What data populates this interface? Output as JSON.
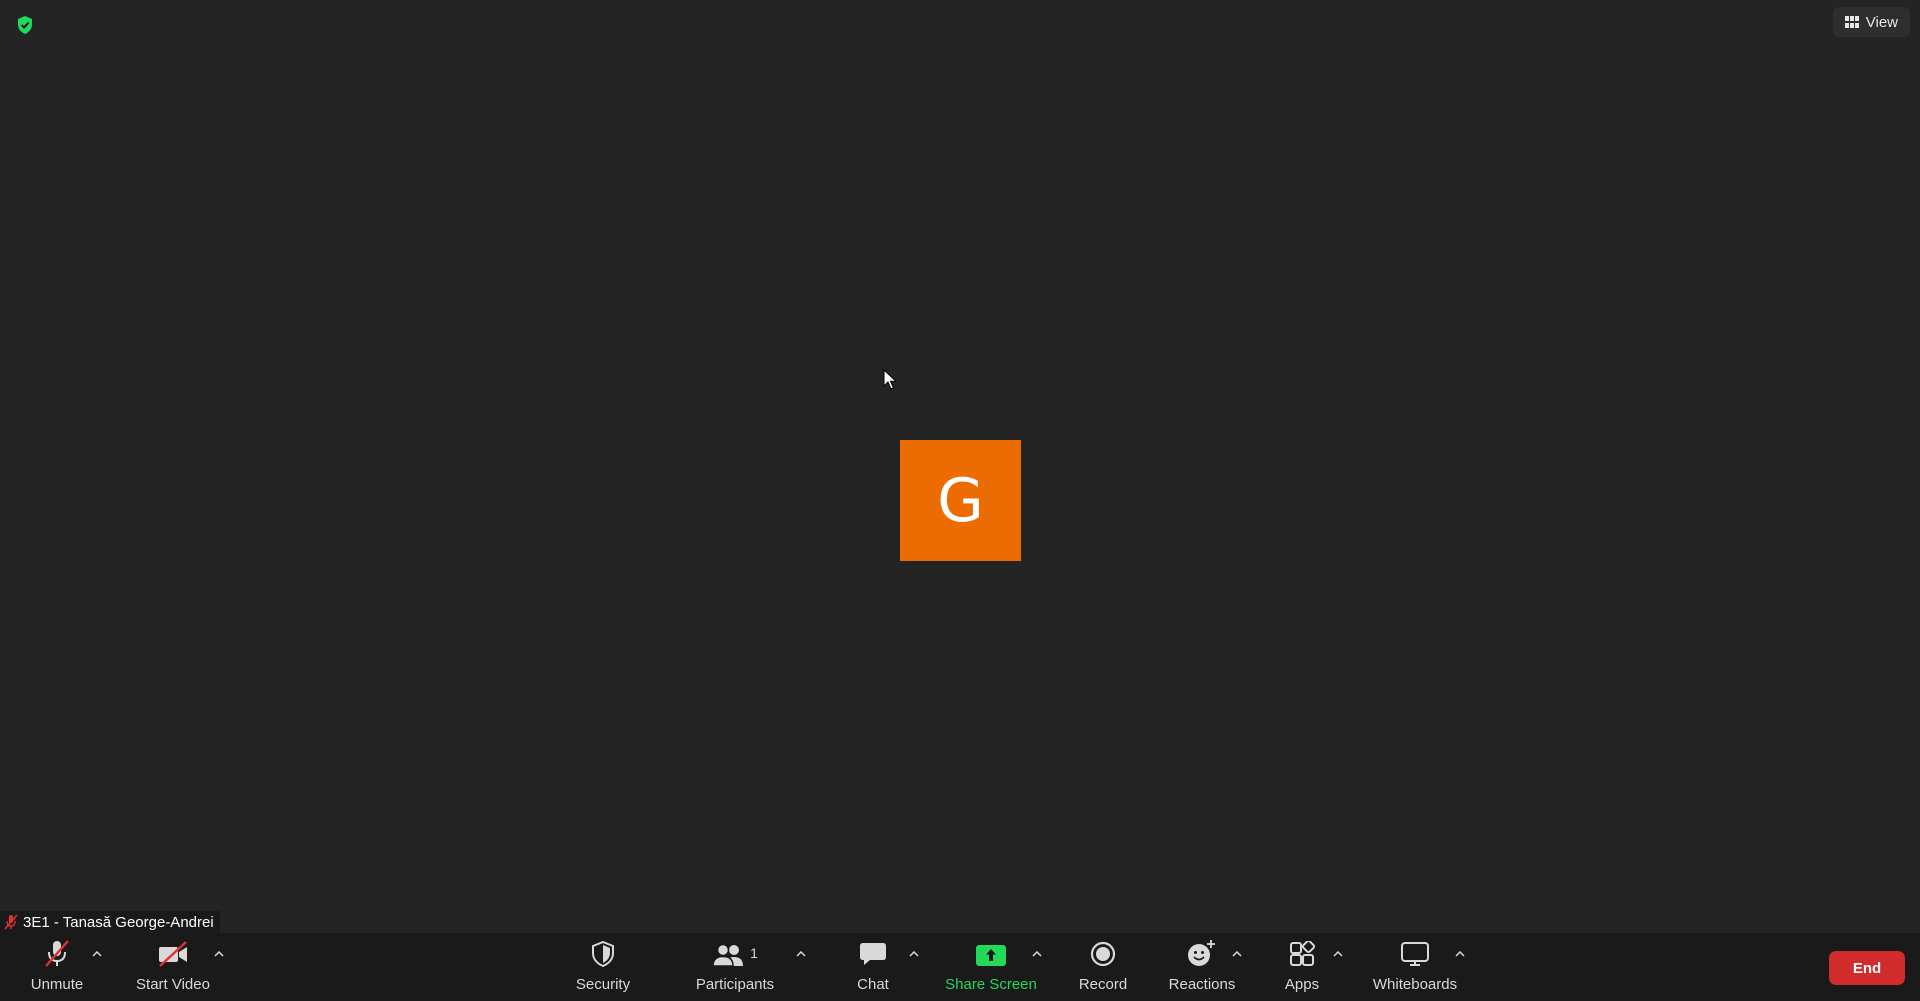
{
  "header": {
    "view_label": "View"
  },
  "participant": {
    "initial": "G",
    "name": "3E1 - Tanasă George-Andrei",
    "avatar_color": "#ed6c02"
  },
  "toolbar": {
    "unmute_label": "Unmute",
    "start_video_label": "Start Video",
    "security_label": "Security",
    "participants_label": "Participants",
    "participants_count": "1",
    "chat_label": "Chat",
    "share_screen_label": "Share Screen",
    "record_label": "Record",
    "reactions_label": "Reactions",
    "apps_label": "Apps",
    "whiteboards_label": "Whiteboards",
    "end_label": "End"
  },
  "colors": {
    "background": "#242424",
    "toolbar": "#1a1a1a",
    "share_green": "#23d959",
    "end_red": "#d12c2c",
    "muted_red": "#e0312f"
  }
}
